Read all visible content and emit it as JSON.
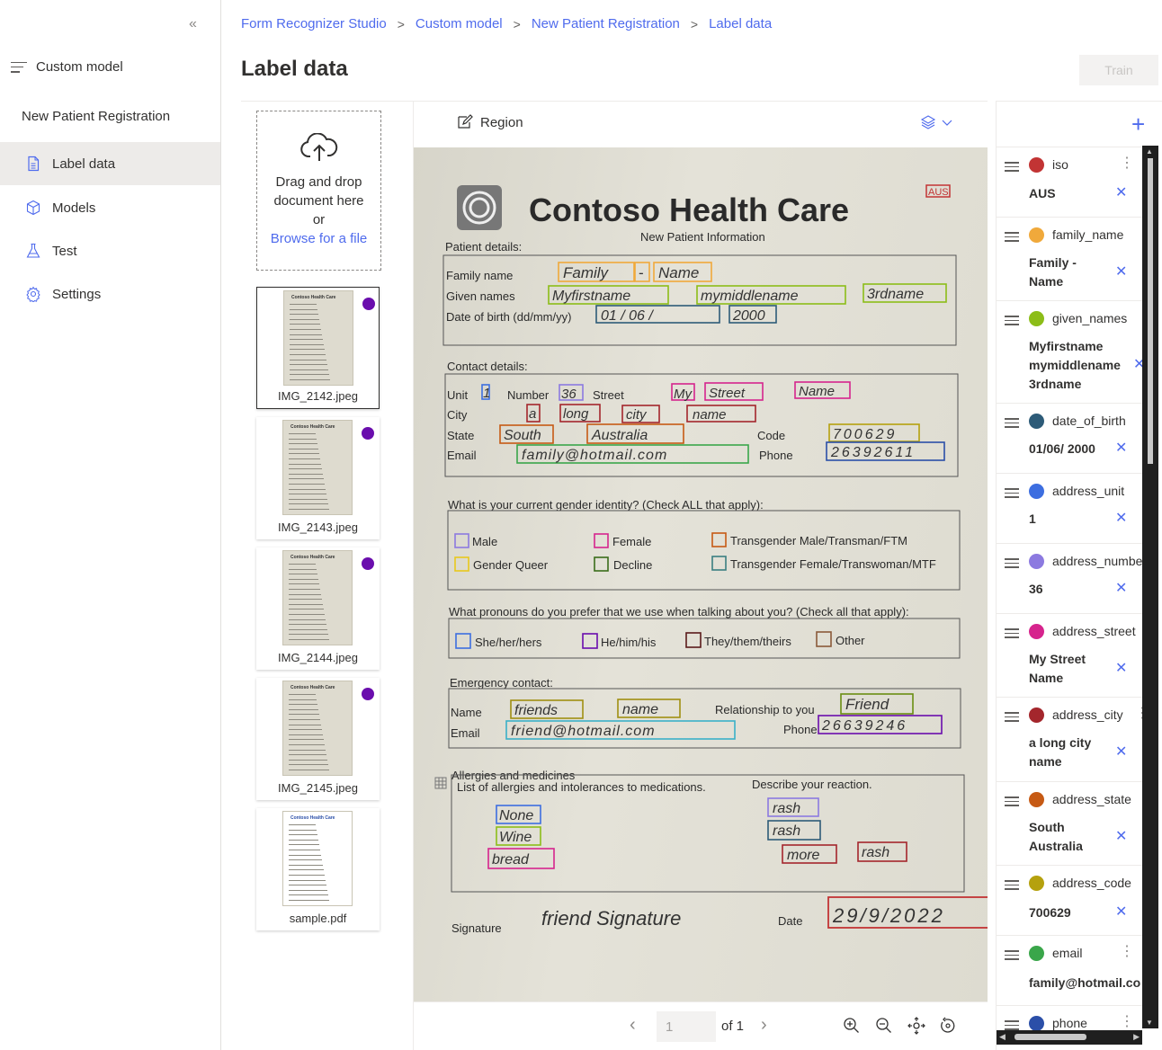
{
  "nav": {
    "collapse_glyph": "«",
    "header_label": "Custom model",
    "project_name": "New Patient Registration",
    "items": [
      {
        "label": "Label data",
        "icon": "document-icon",
        "active": true
      },
      {
        "label": "Models",
        "icon": "cube-icon",
        "active": false
      },
      {
        "label": "Test",
        "icon": "flask-icon",
        "active": false
      },
      {
        "label": "Settings",
        "icon": "gear-icon",
        "active": false
      }
    ]
  },
  "breadcrumb": [
    "Form Recognizer Studio",
    "Custom model",
    "New Patient Registration",
    "Label data"
  ],
  "page_title": "Label data",
  "train_label": "Train",
  "dropzone": {
    "line1": "Drag and drop",
    "line2": "document here",
    "line3": "or",
    "browse": "Browse for a file"
  },
  "files": [
    {
      "name": "IMG_2142.jpeg",
      "labeled": true,
      "selected": true
    },
    {
      "name": "IMG_2143.jpeg",
      "labeled": true,
      "selected": false
    },
    {
      "name": "IMG_2144.jpeg",
      "labeled": true,
      "selected": false
    },
    {
      "name": "IMG_2145.jpeg",
      "labeled": true,
      "selected": false
    },
    {
      "name": "sample.pdf",
      "labeled": false,
      "selected": false
    }
  ],
  "viewer": {
    "region_label": "Region",
    "page_current": "1",
    "page_of": "of 1"
  },
  "document": {
    "title": "Contoso Health Care",
    "subtitle": "New Patient Information",
    "country_badge": "AUS",
    "thumb_header": "Contoso Health Care",
    "patient_section": "Patient details:",
    "family_label": "Family name",
    "given_label": "Given names",
    "dob_label": "Date of birth (dd/mm/yy)",
    "family_hw": [
      "Family",
      "-",
      "Name"
    ],
    "given_hw": [
      "Myfirstname",
      "mymiddlename",
      "3rdname"
    ],
    "dob_hw": [
      "01 / 06 /",
      "2000"
    ],
    "contact_section": "Contact details:",
    "unit_label": "Unit",
    "number_label": "Number",
    "street_label": "Street",
    "city_label": "City",
    "state_label": "State",
    "code_label": "Code",
    "email_label": "Email",
    "phone_label": "Phone",
    "unit_hw": "1",
    "number_hw": "36",
    "street_hw": [
      "My",
      "Street",
      "Name"
    ],
    "city_hw": [
      "a",
      "long",
      "city",
      "name"
    ],
    "state_hw": [
      "South",
      "Australia"
    ],
    "code_hw": "700629",
    "email_hw": "family@hotmail.com",
    "phone_hw": "26392611",
    "gender_question": "What is your current gender identity? (Check ALL that apply):",
    "gender_options": [
      "Male",
      "Female",
      "Transgender Male/Transman/FTM",
      "Gender Queer",
      "Decline",
      "Transgender Female/Transwoman/MTF"
    ],
    "pronoun_question": "What pronouns do you prefer that we use when talking about you? (Check all that apply):",
    "pronoun_options": [
      "She/her/hers",
      "He/him/his",
      "They/them/theirs",
      "Other"
    ],
    "emergency_section": "Emergency contact:",
    "em_name_label": "Name",
    "em_relationship_label": "Relationship to you",
    "em_email_label": "Email",
    "em_phone_label": "Phone",
    "em_name_hw": [
      "friends",
      "name"
    ],
    "em_relationship_hw": "Friend",
    "em_email_hw": "friend@hotmail.com",
    "em_phone_hw": "26639246",
    "allergy_section": "Allergies and medicines",
    "allergy_list_label": "List of allergies and intolerances to medications.",
    "reaction_label": "Describe your reaction.",
    "allergy_hw": [
      "None",
      "Wine",
      "bread"
    ],
    "reaction_hw": [
      "rash",
      "rash",
      "more",
      "rash"
    ],
    "signature_label": "Signature",
    "signature_hw": "friend Signature",
    "date_label": "Date",
    "date_hw": "29/9/2022"
  },
  "fields_panel": {
    "add_glyph": "+",
    "fields": [
      {
        "name": "iso",
        "color": "#c23434",
        "value": [
          "AUS"
        ]
      },
      {
        "name": "family_name",
        "color": "#f0a93b",
        "value": [
          "Family -",
          "Name"
        ]
      },
      {
        "name": "given_names",
        "color": "#8cbd18",
        "value": [
          "Myfirstname",
          "mymiddlename",
          "3rdname"
        ]
      },
      {
        "name": "date_of_birth",
        "color": "#2d5b78",
        "value": [
          "01/06/ 2000"
        ]
      },
      {
        "name": "address_unit",
        "color": "#3d6ee0",
        "value": [
          "1"
        ]
      },
      {
        "name": "address_numbe",
        "color": "#8c7ae0",
        "value": [
          "36"
        ]
      },
      {
        "name": "address_street",
        "color": "#d6248d",
        "value": [
          "My Street",
          "Name"
        ]
      },
      {
        "name": "address_city",
        "color": "#a4262c",
        "value": [
          "a long city",
          "name"
        ]
      },
      {
        "name": "address_state",
        "color": "#c65a14",
        "value": [
          "South",
          "Australia"
        ]
      },
      {
        "name": "address_code",
        "color": "#b5a10e",
        "value": [
          "700629"
        ]
      },
      {
        "name": "email",
        "color": "#3aa64a",
        "value": [
          "family@hotmail.co"
        ]
      },
      {
        "name": "phone",
        "color": "#2b4fa8",
        "value": []
      }
    ]
  },
  "colors": {
    "accent": "#4f6bed",
    "label_dot": "#6a0dad"
  }
}
